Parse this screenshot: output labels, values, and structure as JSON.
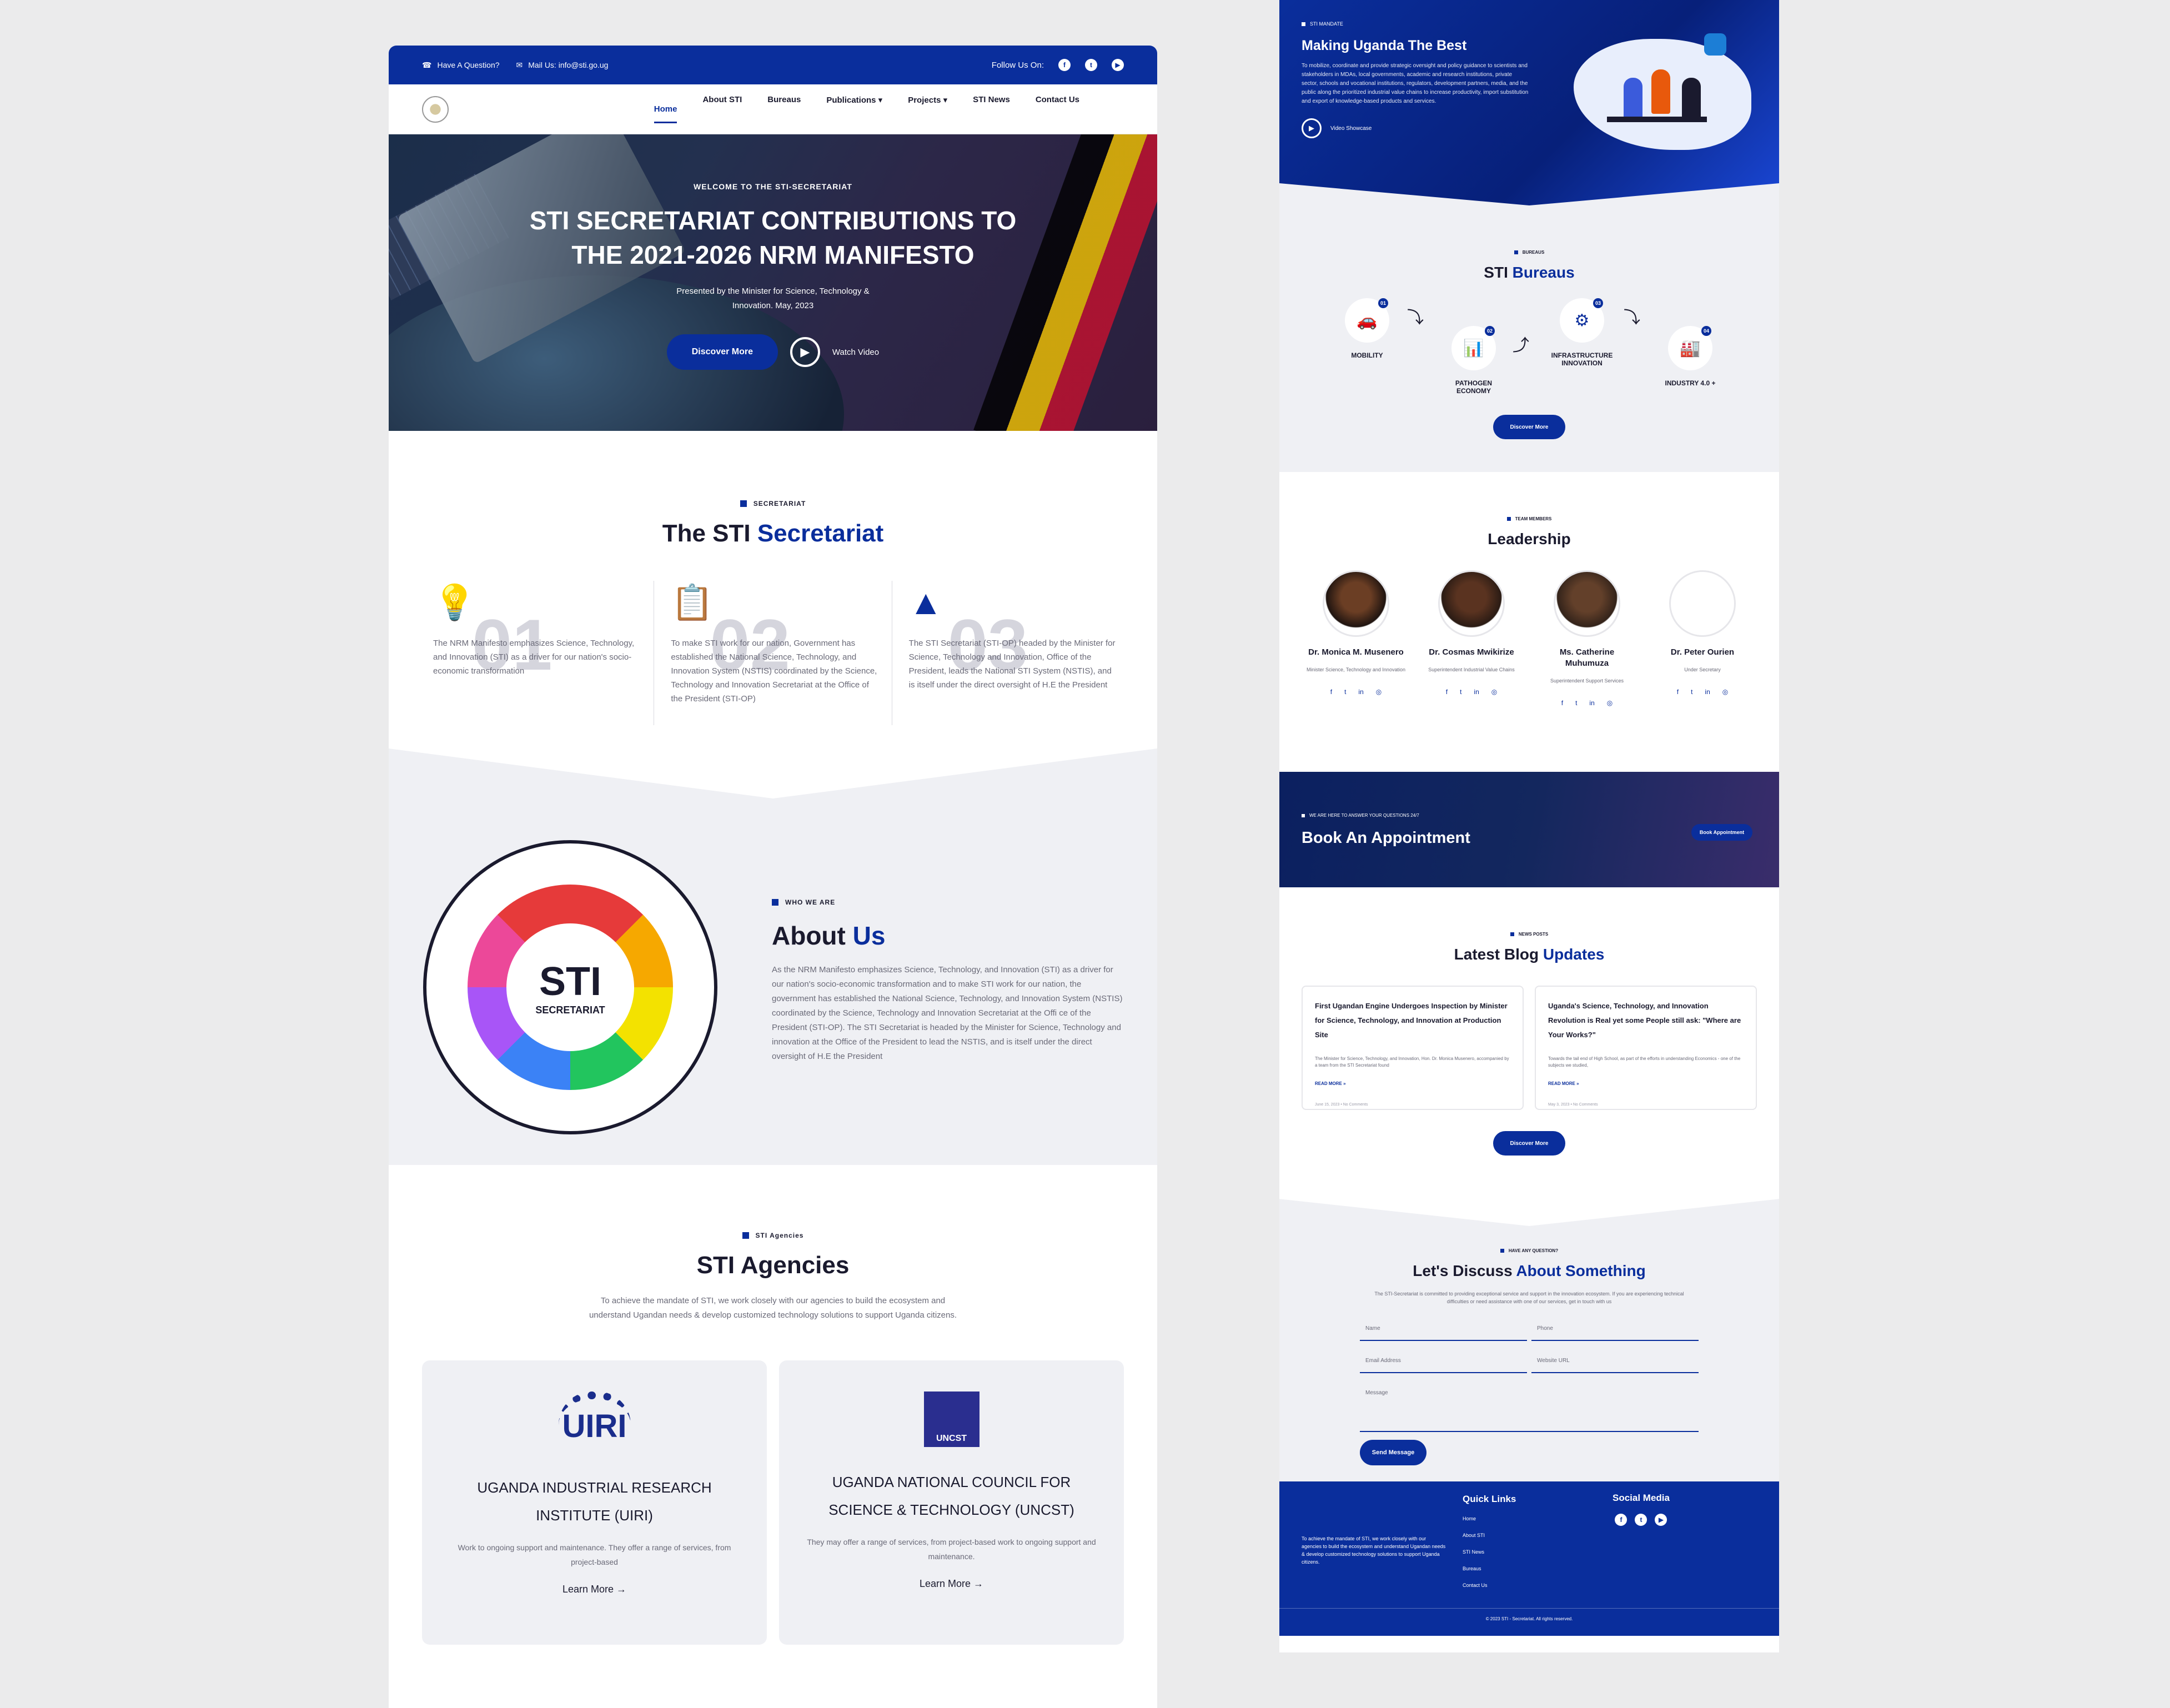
{
  "topbar": {
    "question": "Have A Question?",
    "mail": "Mail Us: info@sti.go.ug",
    "follow": "Follow Us On:",
    "social": [
      "f",
      "t",
      "▶"
    ]
  },
  "nav": {
    "items": [
      "Home",
      "About STI",
      "Bureaus",
      "Publications ▾",
      "Projects ▾",
      "STI News",
      "Contact Us"
    ]
  },
  "hero": {
    "tag": "WELCOME TO THE STI-SECRETARIAT",
    "title_line1": "STI SECRETARIAT CONTRIBUTIONS TO",
    "title_line2": "THE 2021-2026 NRM MANIFESTO",
    "sub_line1": "Presented by the Minister for Science, Technology &",
    "sub_line2": "Innovation. May, 2023",
    "discover": "Discover More",
    "watch": "Watch Video"
  },
  "secretariat": {
    "tag": "SECRETARIAT",
    "title_a": "The STI ",
    "title_b": "Secretariat",
    "cols": [
      {
        "icon": "💡",
        "num": "01",
        "text": "The NRM Manifesto emphasizes Science, Technology, and Innovation (STI) as a driver for our nation's socio-economic transformation"
      },
      {
        "icon": "📋",
        "num": "02",
        "text": "To make STI work for our nation, Government has established the National Science, Technology, and Innovation System (NSTIS) coordinated by the Science, Technology and Innovation Secretariat at the Office of the President (STI-OP)"
      },
      {
        "icon": "▲",
        "num": "03",
        "text": "The STI Secretariat (STI-OP) headed by the Minister for Science, Technology and Innovation, Office of the President, leads the National STI System (NSTIS), and is itself under the direct oversight of H.E the President"
      }
    ]
  },
  "about": {
    "wheel_big": "STI",
    "wheel_small": "SECRETARIAT",
    "tag": "WHO WE ARE",
    "title_a": "About ",
    "title_b": "Us",
    "text": "As the NRM Manifesto emphasizes Science, Technology, and Innovation (STI) as a driver for our nation's socio-economic transformation and to make STI work for our nation, the government has established the National Science, Technology, and Innovation System (NSTIS) coordinated by the Science, Technology and Innovation Secretariat at the Offi ce of the President (STI-OP). The STI Secretariat is headed by the Minister for Science, Technology and innovation at the Office of the President to lead the NSTIS, and is itself under the direct oversight of H.E the President"
  },
  "agencies": {
    "tag": "STI Agencies",
    "title": "STI Agencies",
    "desc": "To achieve the mandate of STI, we work closely with our agencies to build the ecosystem and understand Ugandan needs & develop customized technology solutions to support Uganda citizens.",
    "cards": [
      {
        "logo": "UIRI",
        "name": "UGANDA INDUSTRIAL RESEARCH INSTITUTE (UIRI)",
        "text": "Work to ongoing support and maintenance. They offer a range of services, from project-based",
        "link": "Learn More  →"
      },
      {
        "logo": "UNCST",
        "name": "UGANDA NATIONAL COUNCIL FOR SCIENCE & TECHNOLOGY (UNCST)",
        "text": "They may offer a range of services, from project-based work to ongoing support and maintenance.",
        "link": "Learn More  →"
      }
    ]
  },
  "mandate": {
    "tag": "STI MANDATE",
    "title": "Making Uganda The Best",
    "text": "To mobilize, coordinate and provide strategic oversight and policy guidance to scientists and stakeholders in MDAs, local governments, academic and research institutions, private sector, schools and vocational institutions, regulators, development partners, media, and the public along the prioritized industrial value chains to increase productivity, import substitution and export of knowledge-based products and services.",
    "video": "Video Showcase"
  },
  "bureaus": {
    "tag": "BUREAUS",
    "title_a": "STI ",
    "title_b": "Bureaus",
    "nodes": [
      {
        "n": "01",
        "icon": "🚗",
        "label": "MOBILITY"
      },
      {
        "n": "02",
        "icon": "📊",
        "label": "PATHOGEN ECONOMY"
      },
      {
        "n": "03",
        "icon": "⚙",
        "label": "INFRASTRUCTURE INNOVATION"
      },
      {
        "n": "04",
        "icon": "🏭",
        "label": "INDUSTRY 4.0 +"
      }
    ],
    "discover": "Discover More"
  },
  "leadership": {
    "tag": "TEAM MEMBERS",
    "title": "Leadership",
    "people": [
      {
        "name": "Dr. Monica M. Musenero",
        "role": "Minister Science, Technology and Innovation"
      },
      {
        "name": "Dr. Cosmas Mwikirize",
        "role": "Superintendent Industrial Value Chains"
      },
      {
        "name": "Ms. Catherine Muhumuza",
        "role": "Superintendent Support Services"
      },
      {
        "name": "Dr. Peter Ourien",
        "role": "Under Secretary"
      }
    ]
  },
  "book": {
    "tag": "WE ARE HERE TO ANSWER YOUR QUESTIONS 24/7",
    "title": "Book An Appointment",
    "button": "Book Appointment"
  },
  "blog": {
    "tag": "NEWS POSTS",
    "title_a": "Latest Blog ",
    "title_b": "Updates",
    "posts": [
      {
        "title": "First Ugandan Engine Undergoes Inspection by Minister for Science, Technology, and Innovation at Production Site",
        "excerpt": "The Minister for Science, Technology, and Innovation, Hon. Dr. Monica Musenero, accompanied by a team from the STI Secretariat found",
        "more": "READ MORE »",
        "meta": "June 15, 2023  •  No Comments"
      },
      {
        "title": "Uganda's Science, Technology, and Innovation Revolution is Real yet some People still ask: \"Where are Your Works?\"",
        "excerpt": "Towards the tail end of High School, as part of the efforts in understanding Economics - one of the subjects we studied,",
        "more": "READ MORE »",
        "meta": "May 3, 2023  •  No Comments"
      }
    ],
    "discover": "Discover More"
  },
  "contact": {
    "tag": "HAVE ANY QUESTION?",
    "title_a": "Let's Discuss ",
    "title_b": "About Something",
    "desc": "The STI-Secretariat is committed to providing exceptional service and support in the innovation ecosystem. If you are experiencing technical difficulties or need assistance with one of our services, get in touch with us",
    "name": "Name",
    "phone": "Phone",
    "email": "Email Address",
    "website": "Website URL",
    "message": "Message",
    "send": "Send Message"
  },
  "footer": {
    "about": "To achieve the mandate of STI, we work closely with our agencies to build the ecosystem and understand Ugandan needs & develop customized technology solutions to support Uganda citizens.",
    "ql_title": "Quick Links",
    "links": [
      "Home",
      "About STI",
      "STI News",
      "Bureaus",
      "Contact Us"
    ],
    "sm_title": "Social Media",
    "copy": "© 2023 STI - Secretariat. All rights reserved."
  }
}
